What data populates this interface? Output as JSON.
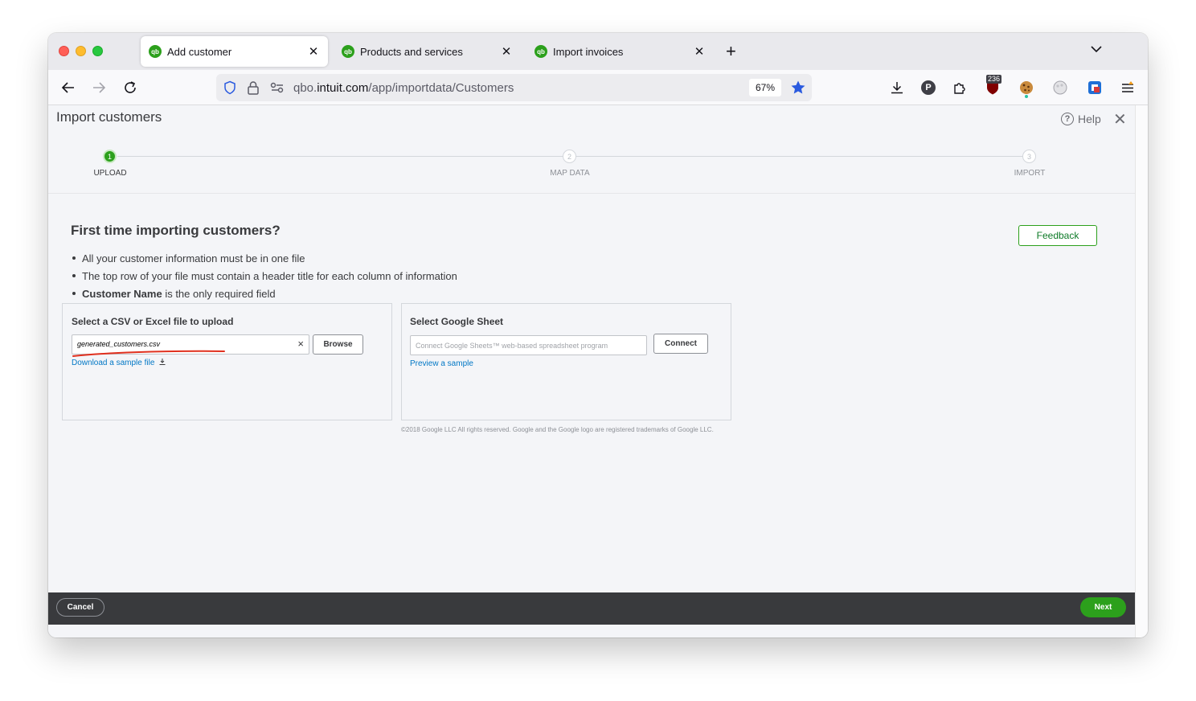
{
  "browser": {
    "tabs": [
      {
        "label": "Add customer",
        "favicon": "qb",
        "active": true
      },
      {
        "label": "Products and services",
        "favicon": "qb",
        "active": false
      },
      {
        "label": "Import invoices",
        "favicon": "qb",
        "active": false
      }
    ],
    "url_prefix": "qbo.",
    "url_domain": "intuit.com",
    "url_path": "/app/importdata/Customers",
    "zoom": "67%",
    "extension_badge": "236",
    "profile_initial": "P"
  },
  "page": {
    "title": "Import customers",
    "help_label": "Help",
    "help_glyph": "?",
    "close_glyph": "✕"
  },
  "stepper": {
    "steps": [
      {
        "number": "1",
        "label": "UPLOAD",
        "state": "done"
      },
      {
        "number": "2",
        "label": "MAP DATA",
        "state": "todo"
      },
      {
        "number": "3",
        "label": "IMPORT",
        "state": "todo"
      }
    ]
  },
  "intro": {
    "heading": "First time importing customers?",
    "bullet1": "All your customer information must be in one file",
    "bullet2": "The top row of your file must contain a header title for each column of information",
    "bullet3_bold": "Customer Name",
    "bullet3_rest": " is the only required field",
    "feedback_label": "Feedback"
  },
  "upload_panel": {
    "title": "Select a CSV or Excel file to upload",
    "file_value": "generated_customers.csv",
    "clear_glyph": "×",
    "browse_label": "Browse",
    "sample_link": "Download a sample file"
  },
  "gsheet_panel": {
    "title": "Select Google Sheet",
    "placeholder": "Connect Google Sheets™ web-based spreadsheet program",
    "connect_label": "Connect",
    "preview_link": "Preview a sample",
    "copyright": "©2018 Google LLC All rights reserved. Google and the Google logo are registered trademarks of Google LLC."
  },
  "footer": {
    "cancel_label": "Cancel",
    "next_label": "Next"
  },
  "colors": {
    "brand_green": "#2ca01c",
    "link_blue": "#0077c5",
    "footer_bg": "#393a3d",
    "annotation_red": "#e0301e"
  }
}
